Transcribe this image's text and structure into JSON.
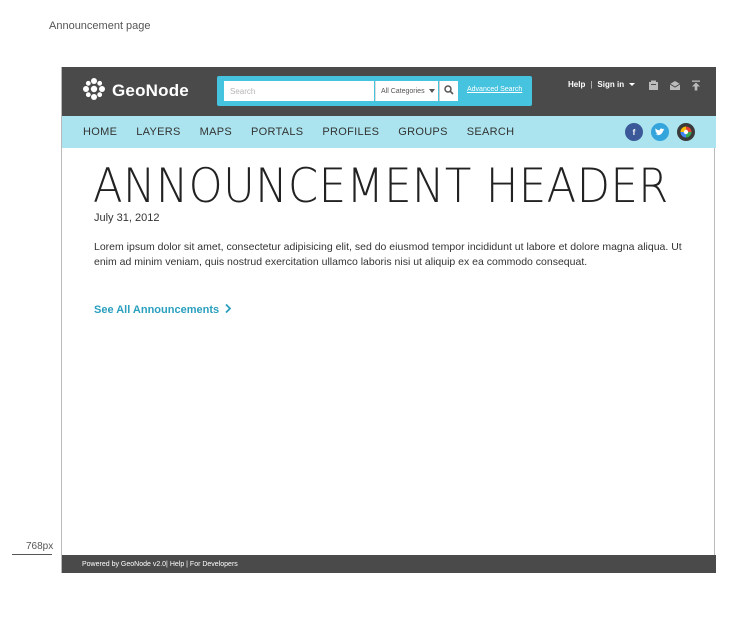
{
  "page_label": "Announcement page",
  "width_label": "768px",
  "header": {
    "logo_text": "GeoNode",
    "search": {
      "placeholder": "Search",
      "category": "All Categories",
      "advanced_link": "Advanced Search"
    },
    "user_links": {
      "help": "Help",
      "separator": "|",
      "sign_in": "Sign in"
    },
    "icons": [
      "upload-box-icon",
      "inbox-icon",
      "upload-arrow-icon"
    ]
  },
  "nav": {
    "items": [
      "HOME",
      "LAYERS",
      "MAPS",
      "PORTALS",
      "PROFILES",
      "GROUPS",
      "SEARCH"
    ],
    "social": {
      "facebook": "f",
      "twitter": "t"
    }
  },
  "content": {
    "title": "ANNOUNCEMENT HEADER",
    "date": "July 31, 2012",
    "body": "Lorem ipsum dolor sit amet, consectetur adipisicing elit, sed do eiusmod tempor incididunt ut labore et dolore magna aliqua. Ut enim ad minim veniam, quis nostrud exercitation ullamco laboris nisi ut aliquip ex ea commodo consequat.",
    "see_all_link": "See All Announcements"
  },
  "footer": {
    "text": "Powered by GeoNode v2.0| Help | For Developers"
  },
  "colors": {
    "topbar": "#4a4a4a",
    "search_accent": "#45c3df",
    "navbar": "#abe4ef",
    "link": "#2a9fbe"
  }
}
